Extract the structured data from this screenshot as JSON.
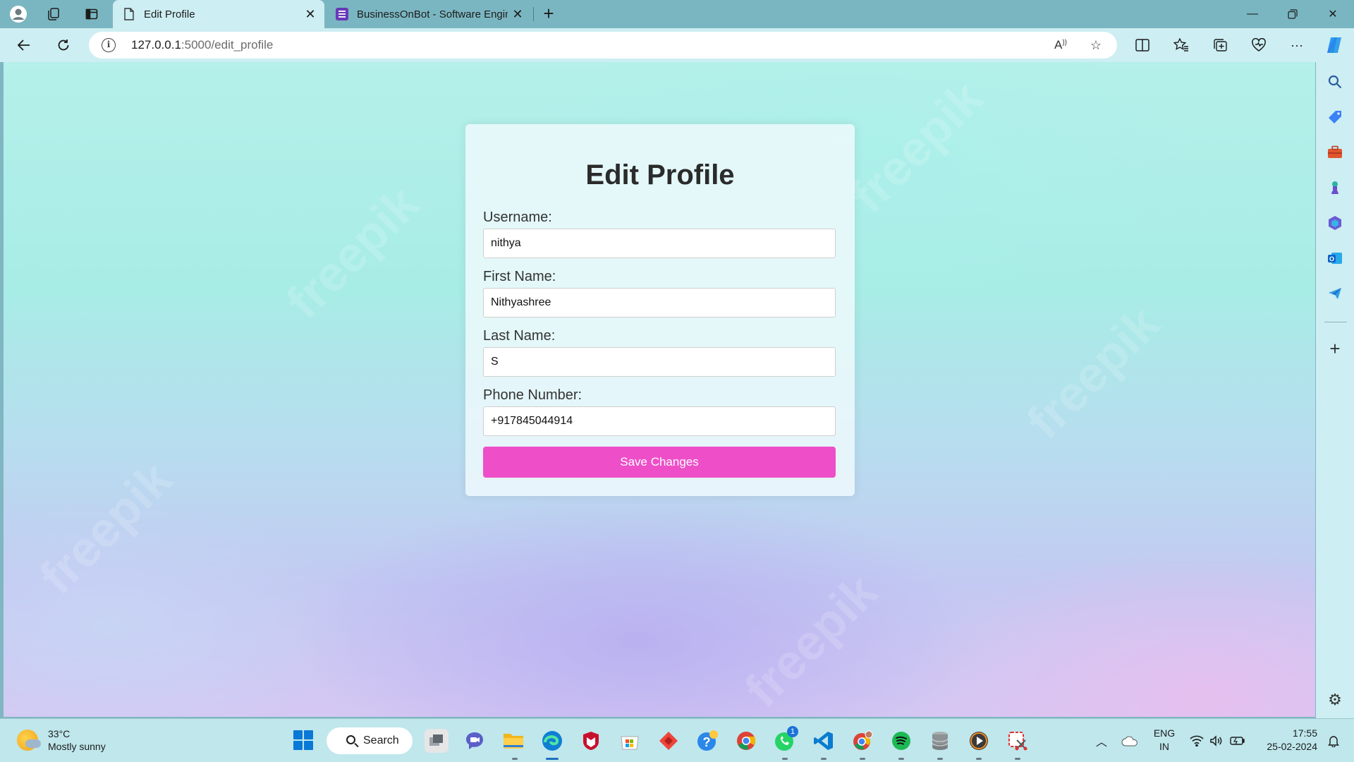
{
  "browser": {
    "tabs": [
      {
        "title": "Edit Profile",
        "active": true
      },
      {
        "title": "BusinessOnBot - Software Engine",
        "active": false
      }
    ],
    "address": {
      "host": "127.0.0.1",
      "path": ":5000/edit_profile"
    }
  },
  "page": {
    "heading": "Edit Profile",
    "fields": [
      {
        "label": "Username:",
        "value": "nithya"
      },
      {
        "label": "First Name:",
        "value": "Nithyashree"
      },
      {
        "label": "Last Name:",
        "value": "S"
      },
      {
        "label": "Phone Number:",
        "value": "+917845044914"
      }
    ],
    "save_label": "Save Changes",
    "watermark": "freepik"
  },
  "taskbar": {
    "weather": {
      "temp": "33°C",
      "condition": "Mostly sunny"
    },
    "search_label": "Search",
    "language": {
      "line1": "ENG",
      "line2": "IN"
    },
    "clock": {
      "time": "17:55",
      "date": "25-02-2024"
    },
    "whatsapp_badge": "1"
  },
  "colors": {
    "accent_button": "#ee4fc8",
    "frame": "#7ab6c1"
  }
}
